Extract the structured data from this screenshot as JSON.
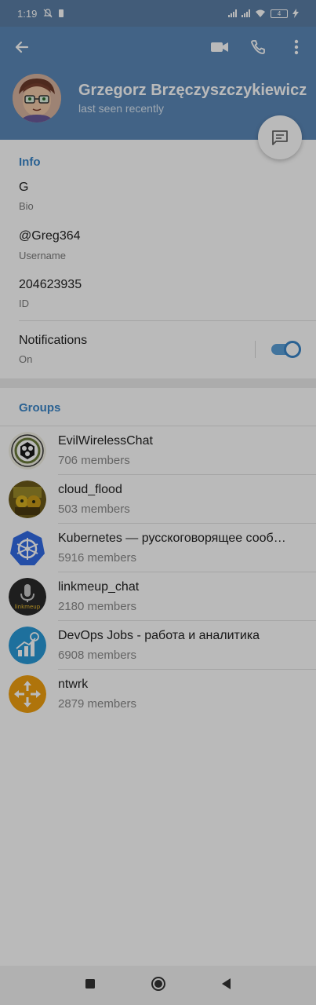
{
  "status_bar": {
    "time": "1:19",
    "battery": "4"
  },
  "header": {
    "name": "Grzegorz Brzęczyszczykiewicz",
    "last_seen": "last seen recently",
    "icons": {
      "back": "arrow-left-icon",
      "video": "video-camera-icon",
      "call": "phone-icon",
      "more": "more-vert-icon",
      "message": "message-icon"
    }
  },
  "info": {
    "title": "Info",
    "bio_value": "G",
    "bio_label": "Bio",
    "username_value": "@Greg364",
    "username_label": "Username",
    "id_value": "204623935",
    "id_label": "ID",
    "notifications_label": "Notifications",
    "notifications_state": "On",
    "notifications_enabled": true
  },
  "groups": {
    "title": "Groups",
    "items": [
      {
        "name": "EvilWirelessChat",
        "members": "706 members"
      },
      {
        "name": "cloud_flood",
        "members": "503 members"
      },
      {
        "name": "Kubernetes — русскоговорящее сообщество",
        "members": "5916 members"
      },
      {
        "name": "linkmeup_chat",
        "members": "2180 members"
      },
      {
        "name": "DevOps Jobs - работа и аналитика",
        "members": "6908 members"
      },
      {
        "name": "ntwrk",
        "members": "2879 members"
      }
    ]
  },
  "avatar_text": {
    "linkmeup": "linkmeup"
  },
  "colors": {
    "header": "#5b88b8",
    "accent": "#3a86c8"
  }
}
